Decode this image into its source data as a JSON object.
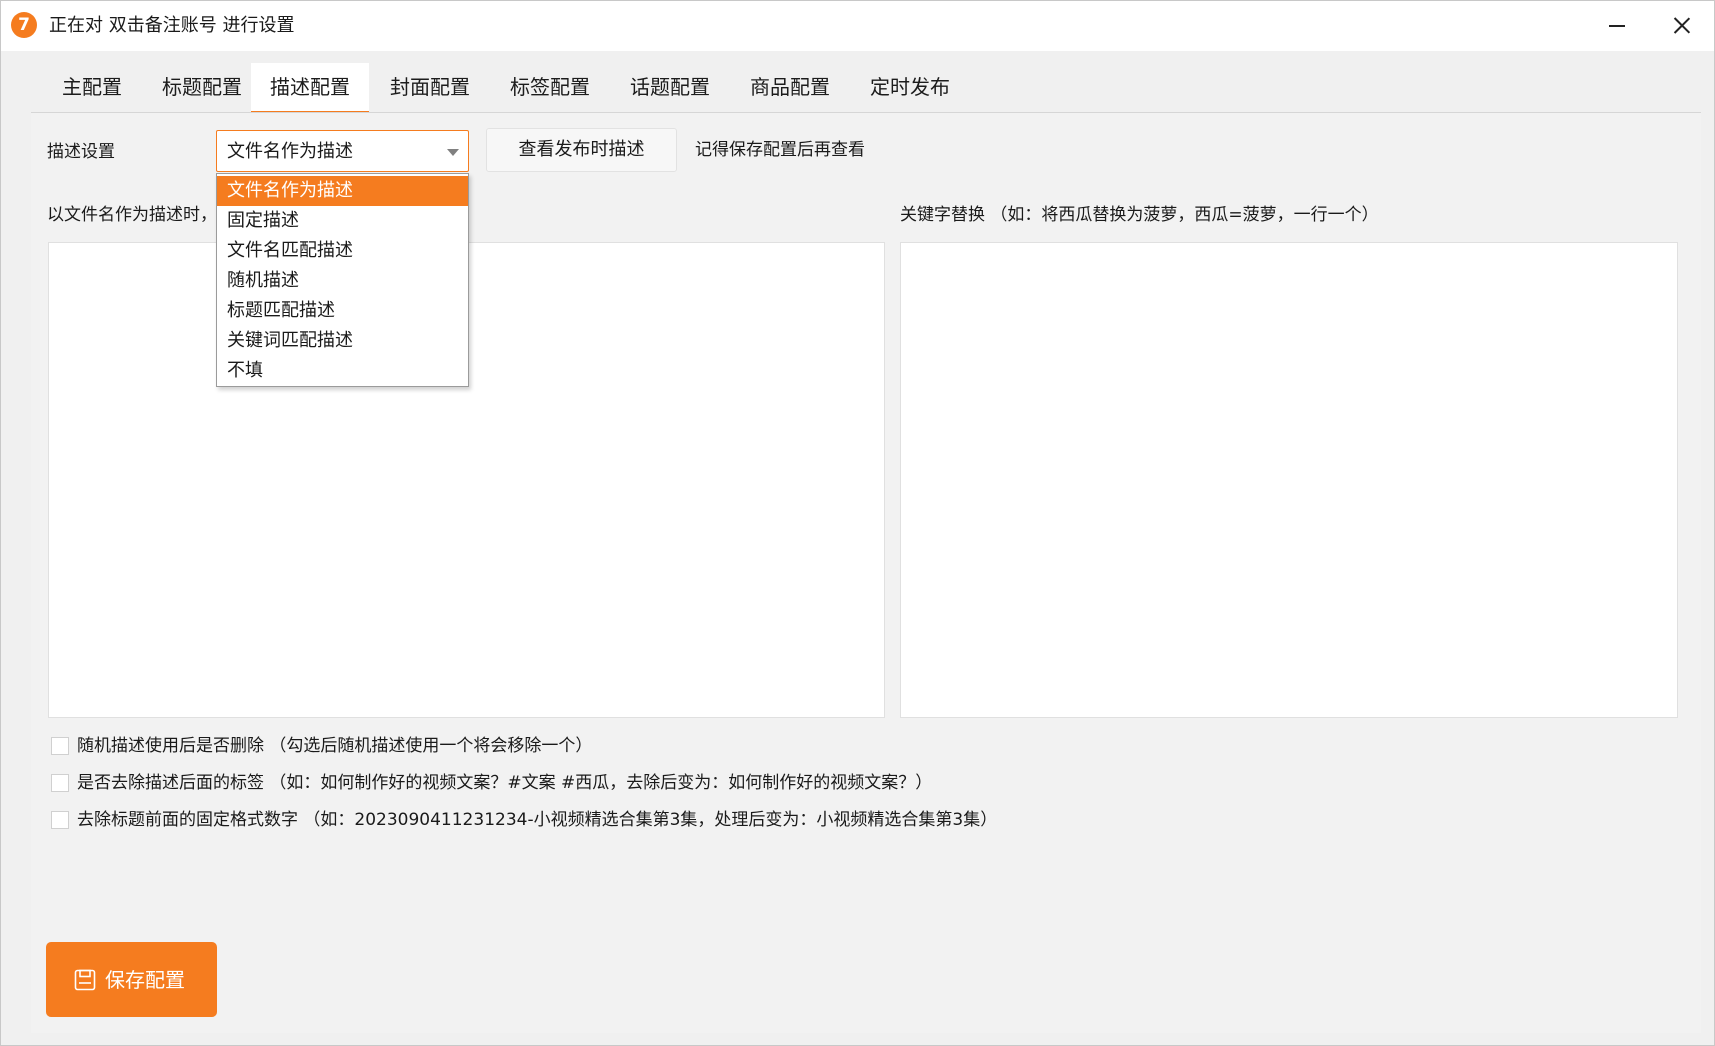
{
  "window": {
    "app_icon_text": "7",
    "title": "正在对 双击备注账号 进行设置"
  },
  "tabs": [
    {
      "label": "主配置"
    },
    {
      "label": "标题配置"
    },
    {
      "label": "描述配置",
      "active": true
    },
    {
      "label": "封面配置"
    },
    {
      "label": "标签配置"
    },
    {
      "label": "话题配置"
    },
    {
      "label": "商品配置"
    },
    {
      "label": "定时发布"
    }
  ],
  "description": {
    "setting_label": "描述设置",
    "select_value": "文件名作为描述",
    "preview_button": "查看发布时描述",
    "hint": "记得保存配置后再查看",
    "left_caption": "以文件名作为描述时，",
    "right_caption": "关键字替换 （如：将西瓜替换为菠萝，西瓜=菠萝，一行一个）",
    "left_text": "",
    "right_text": "",
    "dropdown_options": [
      "文件名作为描述",
      "固定描述",
      "文件名匹配描述",
      "随机描述",
      "标题匹配描述",
      "关键词匹配描述",
      "不填"
    ],
    "selected_index": 0
  },
  "checkboxes": [
    {
      "label": "随机描述使用后是否删除 （勾选后随机描述使用一个将会移除一个）",
      "checked": false
    },
    {
      "label": "是否去除描述后面的标签 （如：如何制作好的视频文案？#文案 #西瓜，去除后变为：如何制作好的视频文案？）",
      "checked": false
    },
    {
      "label": "去除标题前面的固定格式数字 （如：2023090411231234-小视频精选合集第3集，处理后变为：小视频精选合集第3集）",
      "checked": false
    }
  ],
  "save_button": {
    "label": "保存配置",
    "icon": "save-icon"
  },
  "colors": {
    "accent": "#f57c1f",
    "background": "#f0f0f0",
    "panel": "#ffffff"
  }
}
